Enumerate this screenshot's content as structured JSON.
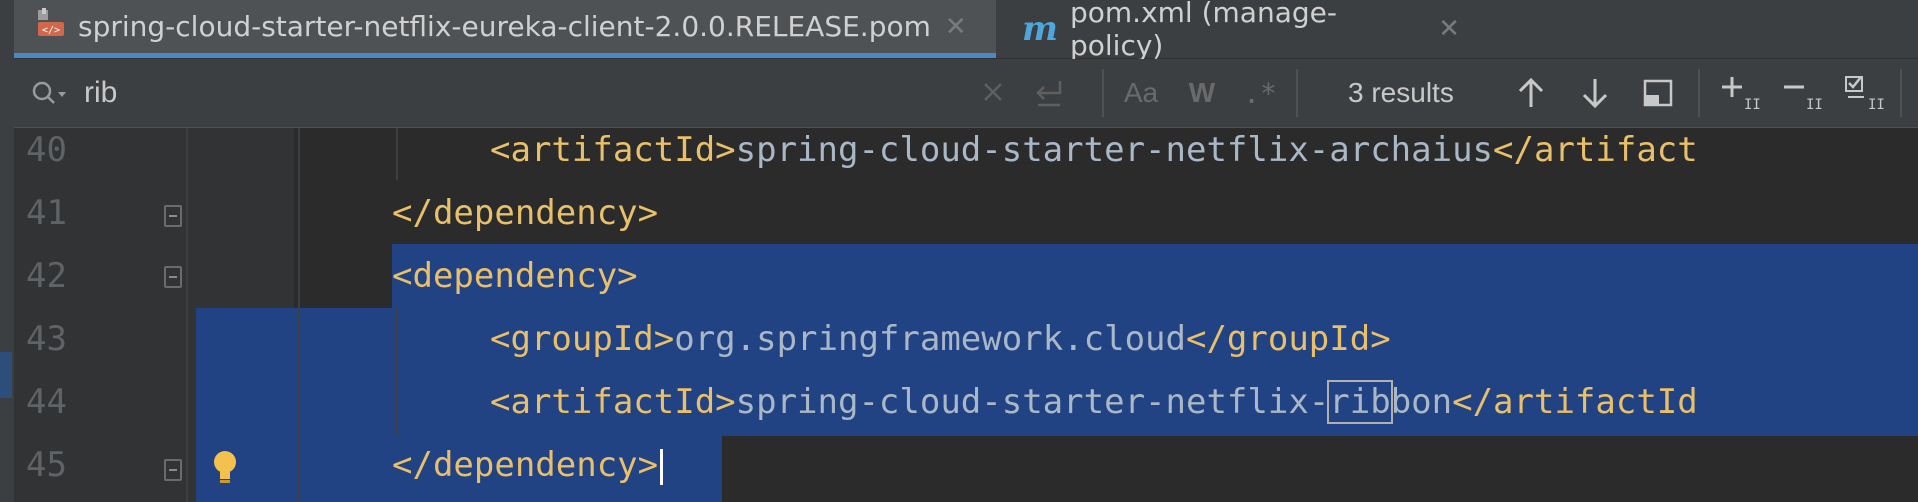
{
  "tabs": [
    {
      "label": "spring-cloud-starter-netflix-eureka-client-2.0.0.RELEASE.pom",
      "icon": "xml-file-icon",
      "active": true
    },
    {
      "label": "pom.xml (manage-policy)",
      "icon": "maven-icon",
      "active": false
    }
  ],
  "search": {
    "query": "rib",
    "results": "3 results",
    "match_case_label": "Aa",
    "words_label": "W",
    "regex_label": ".*"
  },
  "editor": {
    "lines": [
      {
        "num": "40",
        "indent": "        ",
        "tag_open": "<artifactId>",
        "text": "spring-cloud-starter-netflix-archaius",
        "tag_close": "</artifact"
      },
      {
        "num": "41",
        "indent": "    ",
        "tag_open": "</dependency>",
        "text": "",
        "tag_close": ""
      },
      {
        "num": "42",
        "indent": "    ",
        "tag_open": "<dependency>",
        "text": "",
        "tag_close": ""
      },
      {
        "num": "43",
        "indent": "        ",
        "tag_open": "<groupId>",
        "text": "org.springframework.cloud",
        "tag_close": "</groupId>"
      },
      {
        "num": "44",
        "indent": "        ",
        "tag_open": "<artifactId>",
        "text_before": "spring-cloud-starter-netflix-",
        "match": "rib",
        "text_after": "bon",
        "tag_close": "</artifactId"
      },
      {
        "num": "45",
        "indent": "    ",
        "tag_open": "</dependency>",
        "text": "",
        "tag_close": ""
      }
    ]
  },
  "colors": {
    "background": "#2b2b2b",
    "selection": "#214283",
    "tag": "#e8bf6a",
    "text": "#a9b7c6",
    "accent": "#4a88c7"
  }
}
